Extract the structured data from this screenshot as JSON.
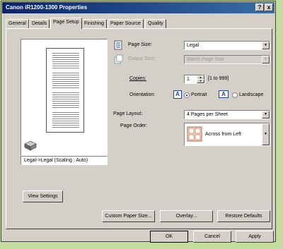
{
  "window": {
    "title": "Canon iR1200-1300 Properties"
  },
  "titlebar_buttons": {
    "help": "?",
    "close": "x"
  },
  "tabs": [
    "General",
    "Details",
    "Page Setup",
    "Finishing",
    "Paper Source",
    "Quality"
  ],
  "preview": {
    "caption": "Legal->Legal (Scaling : Auto)"
  },
  "page_size": {
    "label": "Page Size:",
    "value": "Legal"
  },
  "output_size": {
    "label": "Output Size:",
    "value": "Match Page Size"
  },
  "copies": {
    "label": "Copies:",
    "value": "1",
    "range": "[1 to 999]"
  },
  "orientation": {
    "label": "Orientation:",
    "portrait": "Portrait",
    "landscape": "Landscape",
    "selected": "Portrait"
  },
  "page_layout": {
    "label": "Page Layout:",
    "value": "4 Pages per Sheet"
  },
  "page_order": {
    "label": "Page Order:",
    "value": "Across from Left"
  },
  "buttons": {
    "view_settings": "View Settings",
    "custom_paper_size": "Custom Paper Size...",
    "overlay": "Overlay...",
    "restore_defaults": "Restore Defaults",
    "ok": "OK",
    "cancel": "Cancel",
    "apply": "Apply"
  },
  "colors": {
    "titlebar_start": "#0a246a",
    "dialog_face": "#d4d0c8",
    "background": "#c4dd9e"
  }
}
